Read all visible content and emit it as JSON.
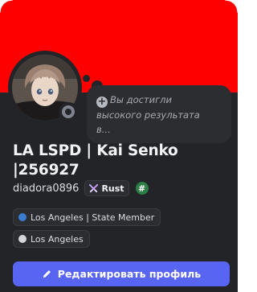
{
  "profile": {
    "banner_color": "#ff0000",
    "display_name_line1": "LA LSPD | Kai Senko",
    "display_name_line2": "|256927",
    "username": "diadora0896",
    "status": "offline",
    "avatar_icon": "anime-avatar"
  },
  "status_bubble": {
    "icon": "plus-icon",
    "text_line1": "Вы достигли",
    "text_line2": "высокого результата",
    "text_line3": "в..."
  },
  "clan_tag": {
    "icon": "swords-icon",
    "label": "Rust",
    "color": "#c9a6ff"
  },
  "badge": {
    "icon": "hashtag-icon",
    "glyph": "#",
    "color": "#2d7d46"
  },
  "roles": [
    {
      "label": "Los Angeles | State Member",
      "color": "#3a7dd1"
    },
    {
      "label": "Los Angeles",
      "color": "#d4d6da"
    }
  ],
  "actions": {
    "edit_profile_label": "Редактировать профиль",
    "edit_icon": "pencil-icon",
    "accent": "#5865f2"
  }
}
